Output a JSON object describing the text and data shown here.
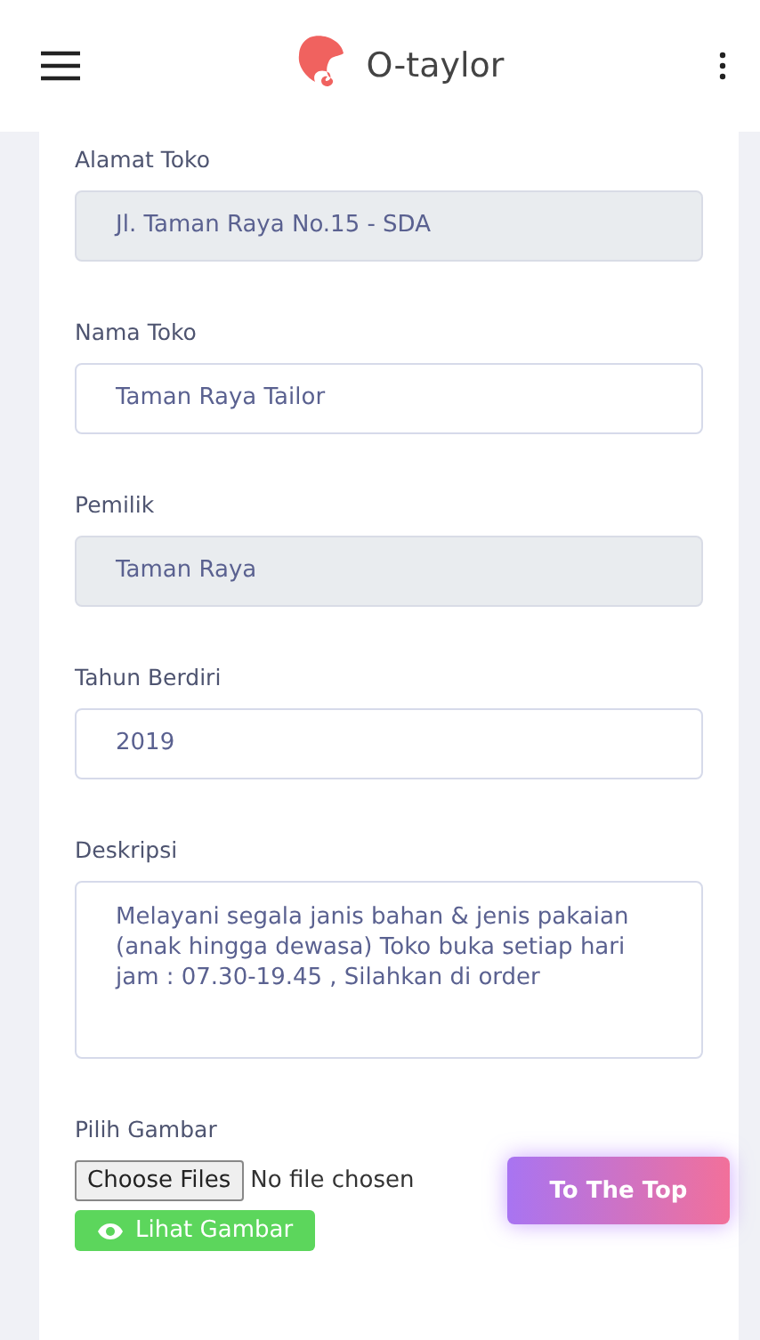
{
  "header": {
    "title": "O-taylor"
  },
  "fields": [
    {
      "label": "Alamat Toko",
      "kind": "input",
      "value": "Jl. Taman Raya No.15 - SDA",
      "disabled": true
    },
    {
      "label": "Nama Toko",
      "kind": "input",
      "value": "Taman Raya Tailor",
      "disabled": false
    },
    {
      "label": "Pemilik",
      "kind": "input",
      "value": "Taman Raya",
      "disabled": true
    },
    {
      "label": "Tahun Berdiri",
      "kind": "input",
      "value": "2019",
      "disabled": false
    },
    {
      "label": "Deskripsi",
      "kind": "textarea",
      "value": "Melayani segala janis bahan & jenis pakaian (anak hingga dewasa) Toko buka setiap hari jam : 07.30-19.45 , Silahkan di order",
      "disabled": false
    }
  ],
  "image_picker": {
    "label": "Pilih Gambar",
    "button": "Choose Files",
    "status": "No file chosen",
    "view_button": "Lihat Gambar"
  },
  "to_top": "To The Top"
}
